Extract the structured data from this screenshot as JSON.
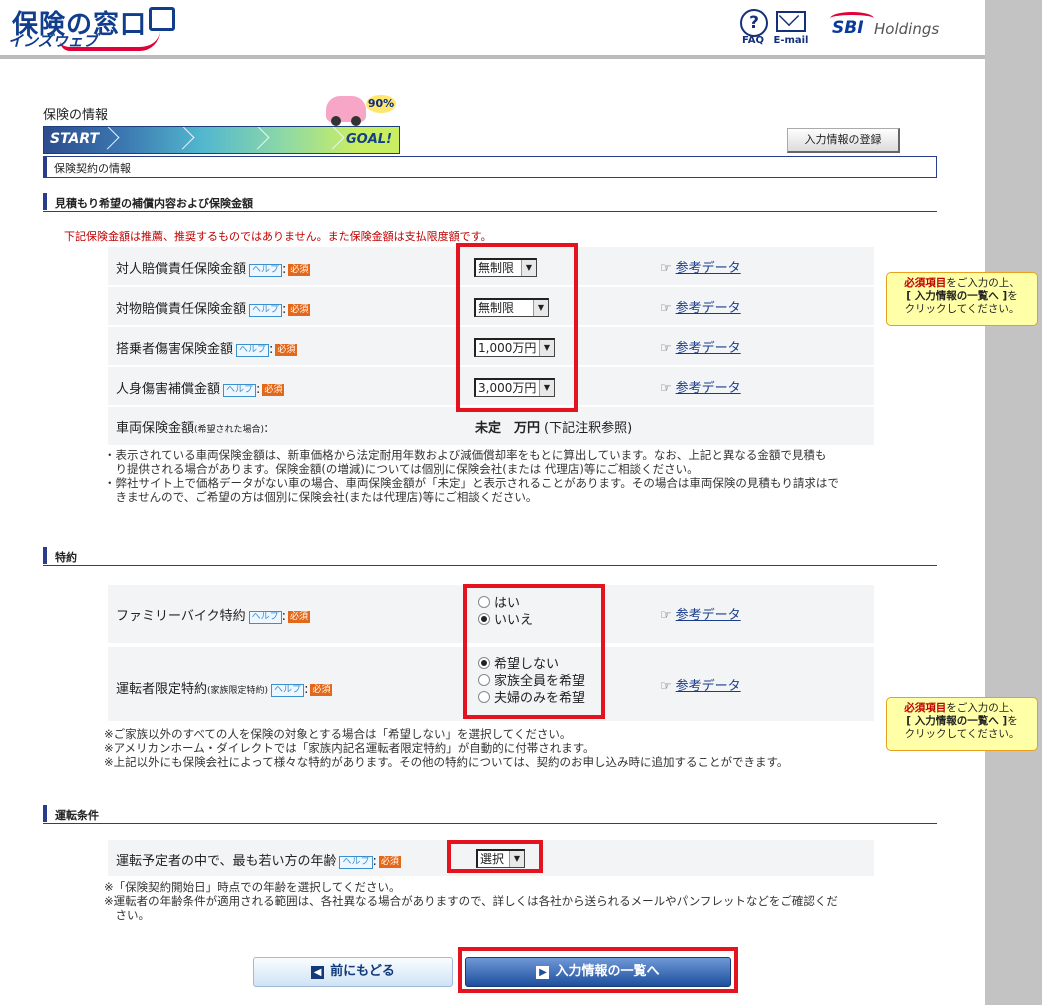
{
  "header": {
    "logo_top": "保険の窓口",
    "logo_bottom": "インズウェブ",
    "faq_label": "FAQ",
    "email_label": "E-mail",
    "holdings_brand": "SBI",
    "holdings_text": "Holdings"
  },
  "page": {
    "title": "保険の情報",
    "progress_percent": "90%",
    "progress_start": "START",
    "progress_goal": "GOAL!",
    "register_button": "入力情報の登録",
    "section_title": "保険契約の情報"
  },
  "coverage": {
    "heading": "見積もり希望の補償内容および保険金額",
    "notice": "下記保険金額は推薦、推奨するものではありません。また保険金額は支払限度額です。",
    "help_label": "ヘルプ",
    "required_label": "必須",
    "reference_link": "参考データ",
    "rows": [
      {
        "label": "対人賠償責任保険金額",
        "value": "無制限"
      },
      {
        "label": "対物賠償責任保険金額",
        "value": "無制限"
      },
      {
        "label": "搭乗者傷害保険金額",
        "value": "1,000万円"
      },
      {
        "label": "人身傷害補償金額",
        "value": "3,000万円"
      }
    ],
    "vehicle_label": "車両保険金額",
    "vehicle_label_small": "(希望された場合)",
    "vehicle_value": "未定　万円",
    "vehicle_note": "(下記注釈参照)",
    "notes": [
      "・表示されている車両保険金額は、新車価格から法定耐用年数および減価償却率をもとに算出しています。なお、上記と異なる金額で見積も",
      "　り提供される場合があります。保険金額(の増減)については個別に保険会社(または 代理店)等にご相談ください。",
      "・弊社サイト上で価格データがない車の場合、車両保険金額が「未定」と表示されることがあります。その場合は車両保険の見積もり請求はで",
      "　きませんので、ご希望の方は個別に保険会社(または代理店)等にご相談ください。"
    ]
  },
  "tokuyaku": {
    "heading": "特約",
    "family_bike_label": "ファミリーバイク特約",
    "family_bike_options": [
      "はい",
      "いいえ"
    ],
    "family_bike_selected": 1,
    "driver_label": "運転者限定特約",
    "driver_label_small": "(家族限定特約)",
    "driver_options": [
      "希望しない",
      "家族全員を希望",
      "夫婦のみを希望"
    ],
    "driver_selected": 0,
    "notes": [
      "※ご家族以外のすべての人を保険の対象とする場合は「希望しない」を選択してください。",
      "※アメリカンホーム・ダイレクトでは「家族内記名運転者限定特約」が自動的に付帯されます。",
      "※上記以外にも保険会社によって様々な特約があります。その他の特約については、契約のお申し込み時に追加することができます。"
    ]
  },
  "driving": {
    "heading": "運転条件",
    "age_label": "運転予定者の中で、最も若い方の年齢",
    "age_value": "選択",
    "notes": [
      "※「保険契約開始日」時点での年齢を選択してください。",
      "※運転者の年齢条件が適用される範囲は、各社異なる場合がありますので、詳しくは各社から送られるメールやパンフレットなどをご確認くだ",
      "　さい。"
    ]
  },
  "tooltip": {
    "required_word": "必須項目",
    "line1_rest": "をご入力の上、",
    "line2": "[ 入力情報の一覧へ ]",
    "line2_rest": "を",
    "line3": "クリックしてください。"
  },
  "buttons": {
    "back": "前にもどる",
    "next": "入力情報の一覧へ"
  }
}
